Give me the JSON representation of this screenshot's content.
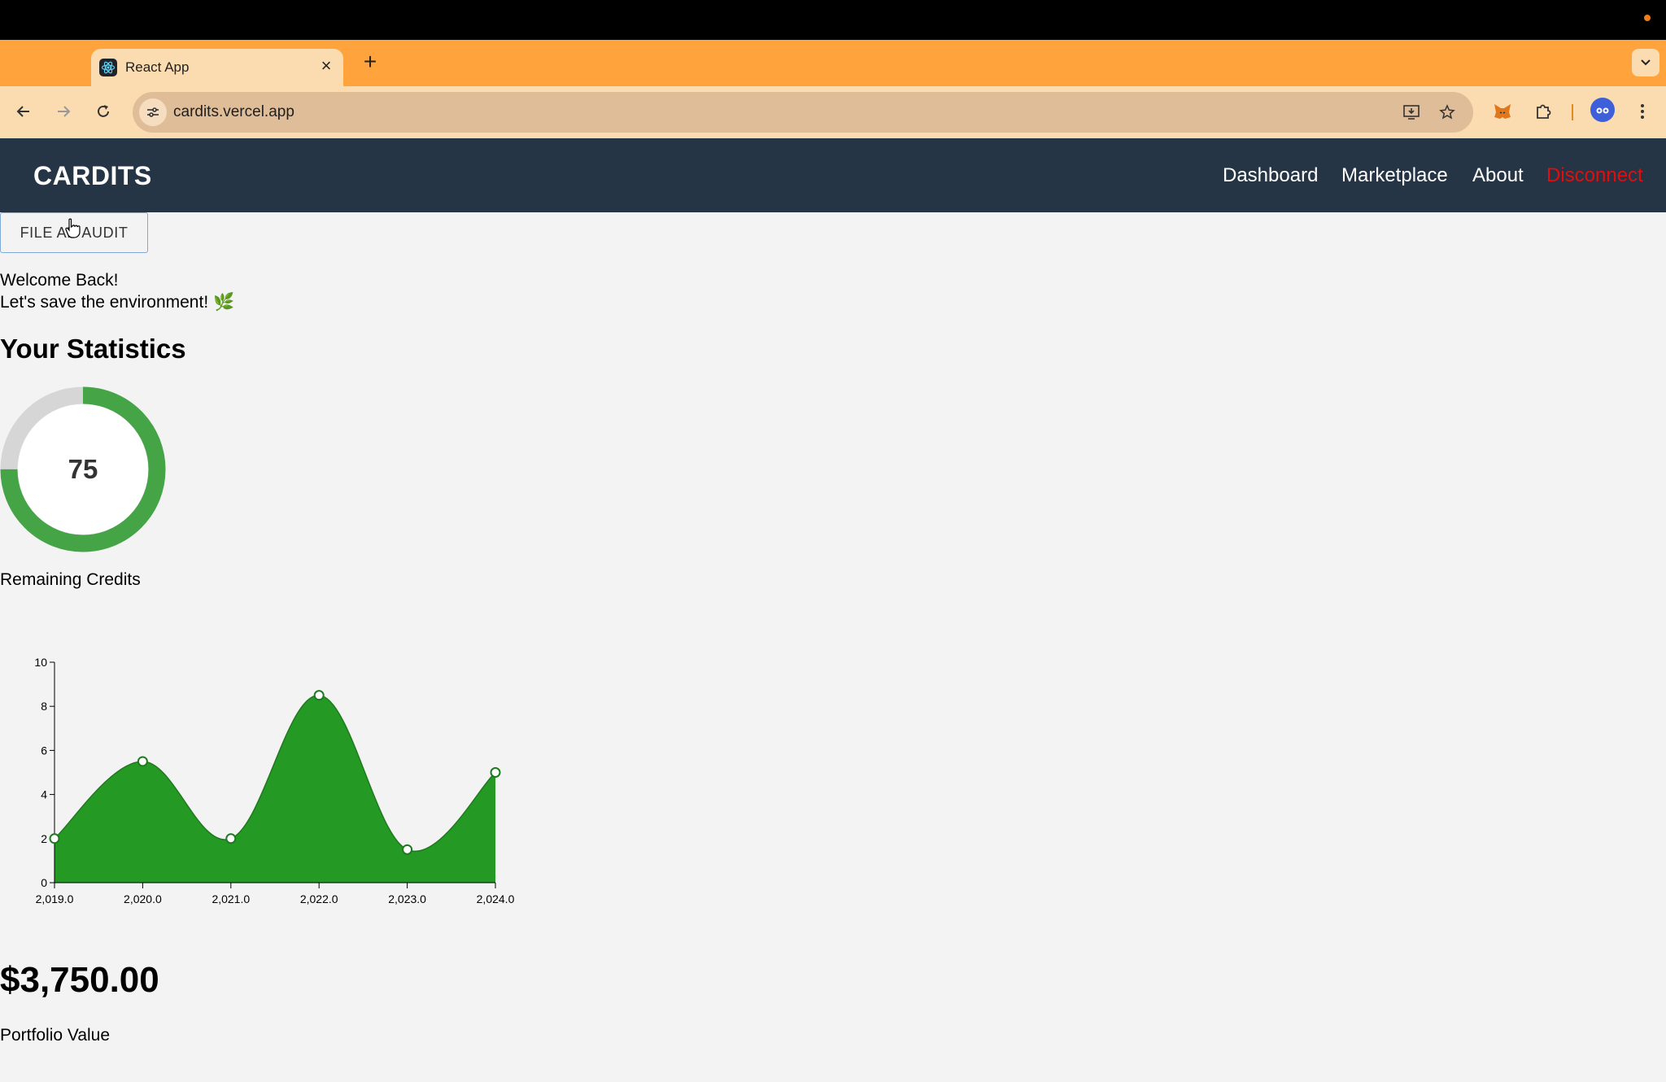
{
  "browser": {
    "tab_title": "React App",
    "url": "cardits.vercel.app",
    "icons": [
      "react-favicon",
      "close-icon",
      "plus-icon",
      "chevron-down-icon",
      "back-arrow-icon",
      "forward-arrow-icon",
      "reload-icon",
      "site-info-icon",
      "install-app-icon",
      "star-icon",
      "metamask-icon",
      "puzzle-icon",
      "profile-icon",
      "kebab-menu-icon"
    ]
  },
  "app": {
    "brand": "CARDITS",
    "nav": {
      "dashboard": "Dashboard",
      "marketplace": "Marketplace",
      "about": "About",
      "disconnect": "Disconnect"
    },
    "accent_colors": {
      "nav_bg": "#253545",
      "disconnect": "#e40d0d",
      "chart_fill": "#249924",
      "gauge": "#44a446"
    }
  },
  "page": {
    "audit_button": "FILE AN AUDIT",
    "welcome": "Welcome Back!",
    "tagline": "Let's save the environment! 🌿",
    "stats_title": "Your Statistics",
    "credits": {
      "value": "75",
      "percent": 75,
      "label": "Remaining Credits"
    },
    "portfolio": {
      "value": "$3,750.00",
      "label": "Portfolio Value"
    }
  },
  "chart_data": {
    "type": "area",
    "x": [
      2019,
      2020,
      2021,
      2022,
      2023,
      2024
    ],
    "x_tick_labels": [
      "2,019.0",
      "2,020.0",
      "2,021.0",
      "2,022.0",
      "2,023.0",
      "2,024.0"
    ],
    "values": [
      2,
      5.5,
      2,
      8.5,
      1.5,
      5
    ],
    "ylim": [
      0,
      10
    ],
    "y_ticks": [
      "0",
      "2",
      "4",
      "6",
      "8",
      "10"
    ],
    "title": "",
    "xlabel": "",
    "ylabel": "",
    "color": "#249924"
  }
}
